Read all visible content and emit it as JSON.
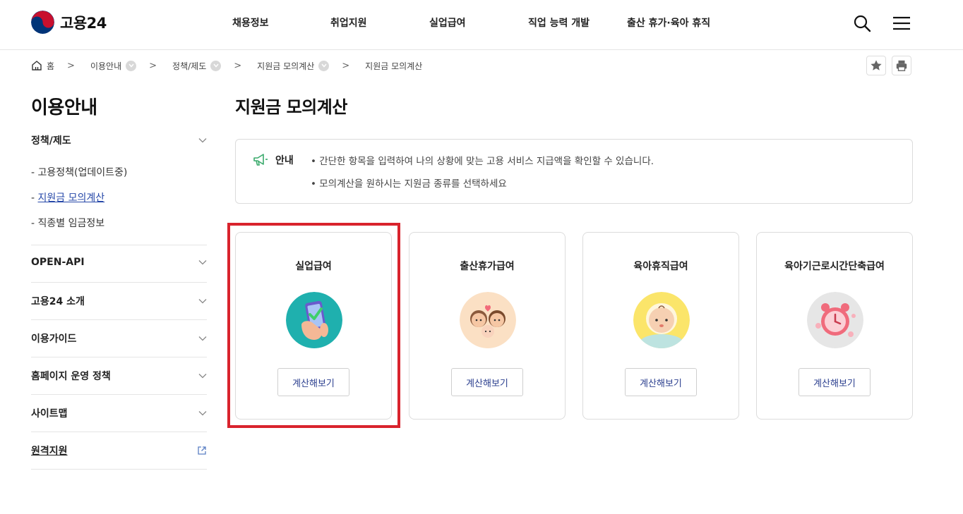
{
  "header": {
    "logo_text": "고용24",
    "nav": [
      "채용정보",
      "취업지원",
      "실업급여",
      "직업 능력 개발",
      "출산 휴가·육아 휴직"
    ],
    "search_icon": "search-icon",
    "menu_icon": "hamburger-icon"
  },
  "breadcrumb": {
    "items": [
      "홈",
      "이용안내",
      "정책/제도",
      "지원금 모의계산",
      "지원금 모의계산"
    ],
    "home_icon": "home-icon",
    "favorite_icon": "star-icon",
    "print_icon": "print-icon"
  },
  "sidebar": {
    "title": "이용안내",
    "groups": [
      {
        "label": "정책/제도",
        "subs": [
          "- 고용정책(업데이트중)",
          "- 지원금 모의계산",
          "- 직종별 임금정보"
        ]
      },
      {
        "label": "OPEN-API"
      },
      {
        "label": "고용24 소개"
      },
      {
        "label": "이용가이드"
      },
      {
        "label": "홈페이지 운영 정책"
      },
      {
        "label": "사이트맵"
      },
      {
        "label": "원격지원"
      }
    ],
    "active_sub_prefix": "- ",
    "active_sub_text": "지원금 모의계산"
  },
  "main": {
    "title": "지원금 모의계산",
    "notice": {
      "label": "안내",
      "lines": [
        "• 간단한 항목을 입력하여 나의 상황에 맞는 고용 서비스 지급액을 확인할 수 있습니다.",
        "• 모의계산을 원하시는 지원금 종류를 선택하세요"
      ]
    },
    "cards": [
      {
        "title": "실업급여",
        "button": "계산해보기",
        "icon": "phone-check-icon"
      },
      {
        "title": "출산휴가급여",
        "button": "계산해보기",
        "icon": "couple-baby-icon"
      },
      {
        "title": "육아휴직급여",
        "button": "계산해보기",
        "icon": "baby-icon"
      },
      {
        "title": "육아기근로시간단축급여",
        "button": "계산해보기",
        "icon": "alarm-clock-icon"
      }
    ]
  },
  "colors": {
    "accent_red": "#d9232d",
    "link_blue": "#2547a8",
    "logo_red": "#c8102e",
    "logo_blue": "#003478"
  }
}
